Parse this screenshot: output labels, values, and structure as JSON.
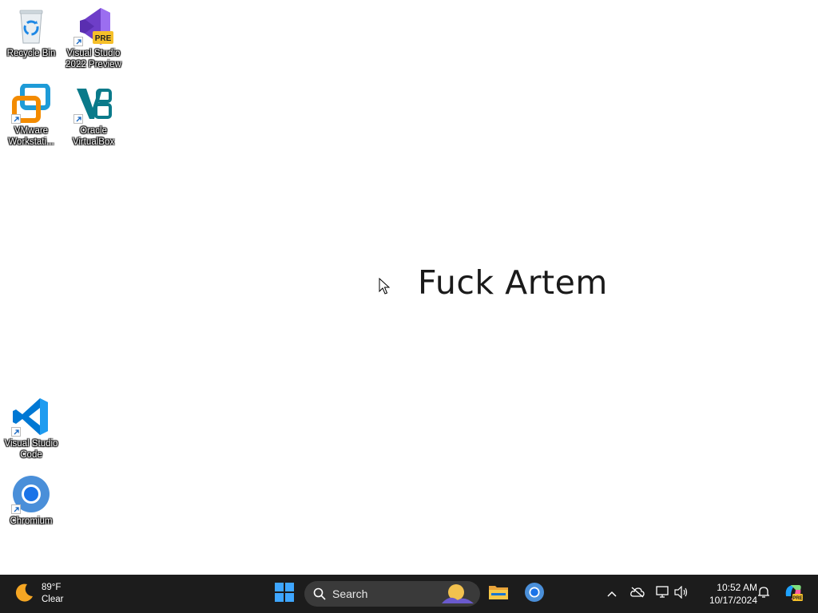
{
  "desktop": {
    "icons": [
      {
        "label": "Recycle Bin",
        "icon": "recycle-bin-icon"
      },
      {
        "label": "Visual Studio 2022 Preview",
        "icon": "visual-studio-preview-icon",
        "badge": "PRE"
      },
      {
        "label": "VMware Workstati...",
        "icon": "vmware-icon"
      },
      {
        "label": "Oracle VirtualBox",
        "icon": "virtualbox-icon"
      },
      {
        "label": "Visual Studio Code",
        "icon": "vscode-icon"
      },
      {
        "label": "Chromium",
        "icon": "chromium-icon"
      }
    ],
    "wallpaper_text": "Fuck Artem"
  },
  "taskbar": {
    "weather": {
      "temperature": "89°F",
      "condition": "Clear",
      "icon": "moon-icon"
    },
    "start_icon": "windows-start-icon",
    "search": {
      "label": "Search"
    },
    "pinned": [
      {
        "name": "file-explorer",
        "icon": "folder-icon"
      },
      {
        "name": "chromium",
        "icon": "chromium-icon"
      }
    ],
    "tray": {
      "icons": [
        "chevron-up-icon",
        "cloud-offline-icon",
        "network-icon",
        "volume-icon",
        "notification-bell-icon",
        "copilot-icon"
      ]
    },
    "clock": {
      "time": "10:52 AM",
      "date": "10/17/2024"
    }
  },
  "colors": {
    "taskbar_bg": "#1c1c1c",
    "desktop_bg": "#ffffff",
    "windows_blue": "#0078d4"
  }
}
